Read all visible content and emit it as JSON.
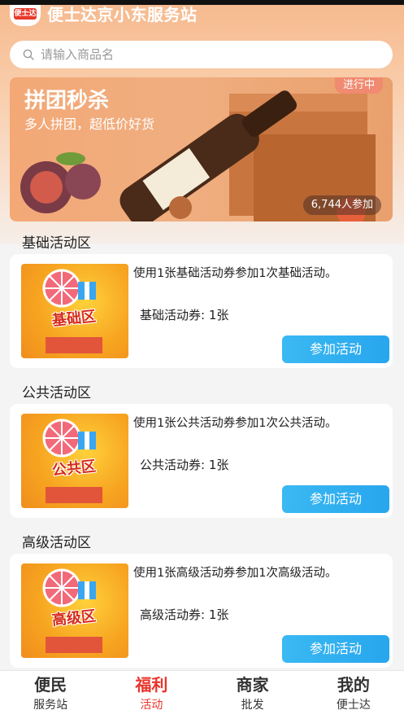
{
  "app": {
    "logo_text": "便士达",
    "title": "便士达京小东服务站"
  },
  "search": {
    "placeholder": "请输入商品名",
    "value": ""
  },
  "banner": {
    "title": "拼团秒杀",
    "subtitle": "多人拼团，超低价好货",
    "status": "进行中",
    "participants": "6,744人参加"
  },
  "sections": [
    {
      "label": "基础活动区",
      "thumb_text": "基础区",
      "description": "使用1张基础活动券参加1次基础活动。",
      "ticket": "基础活动券: 1张",
      "button": "参加活动"
    },
    {
      "label": "公共活动区",
      "thumb_text": "公共区",
      "description": "使用1张公共活动券参加1次公共活动。",
      "ticket": "公共活动券: 1张",
      "button": "参加活动"
    },
    {
      "label": "高级活动区",
      "thumb_text": "高级区",
      "description": "使用1张高级活动券参加1次高级活动。",
      "ticket": "高级活动券: 1张",
      "button": "参加活动"
    }
  ],
  "tabbar": [
    {
      "top": "便民",
      "bottom": "服务站",
      "active": false
    },
    {
      "top": "福利",
      "bottom": "活动",
      "active": true
    },
    {
      "top": "商家",
      "bottom": "批发",
      "active": false
    },
    {
      "top": "我的",
      "bottom": "便士达",
      "active": false
    }
  ],
  "colors": {
    "accent_red": "#e8342a",
    "button_blue": "#28a6ee",
    "header_orange": "#f6b98d"
  }
}
